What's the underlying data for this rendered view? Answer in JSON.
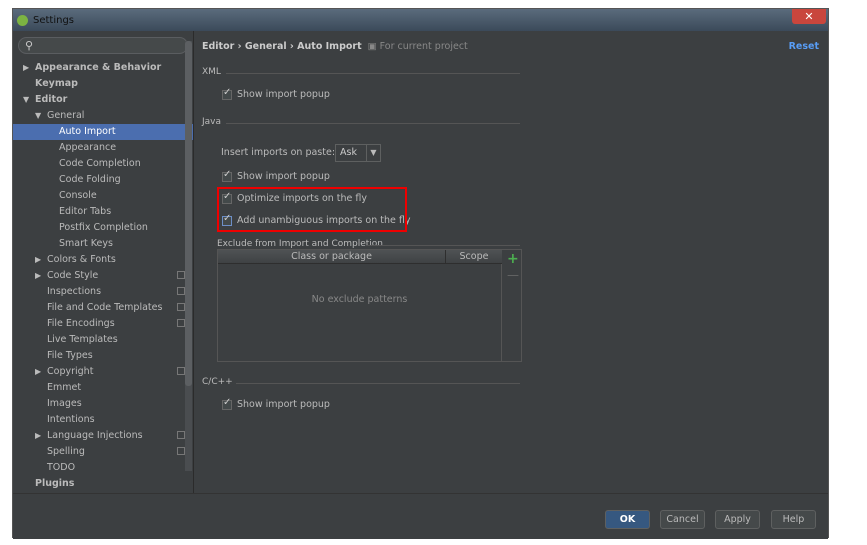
{
  "window": {
    "title": "Settings",
    "close": "✕"
  },
  "search": {
    "placeholder": ""
  },
  "tree": [
    {
      "label": "Appearance & Behavior",
      "level": 0,
      "bold": true,
      "arrow": "▶"
    },
    {
      "label": "Keymap",
      "level": 0,
      "bold": true,
      "arrow": ""
    },
    {
      "label": "Editor",
      "level": 0,
      "bold": true,
      "arrow": "▼"
    },
    {
      "label": "General",
      "level": 1,
      "arrow": "▼"
    },
    {
      "label": "Auto Import",
      "level": 2,
      "selected": true
    },
    {
      "label": "Appearance",
      "level": 2
    },
    {
      "label": "Code Completion",
      "level": 2
    },
    {
      "label": "Code Folding",
      "level": 2
    },
    {
      "label": "Console",
      "level": 2
    },
    {
      "label": "Editor Tabs",
      "level": 2
    },
    {
      "label": "Postfix Completion",
      "level": 2
    },
    {
      "label": "Smart Keys",
      "level": 2
    },
    {
      "label": "Colors & Fonts",
      "level": 1,
      "arrow": "▶"
    },
    {
      "label": "Code Style",
      "level": 1,
      "arrow": "▶",
      "project": true
    },
    {
      "label": "Inspections",
      "level": 1,
      "project": true
    },
    {
      "label": "File and Code Templates",
      "level": 1,
      "project": true
    },
    {
      "label": "File Encodings",
      "level": 1,
      "project": true
    },
    {
      "label": "Live Templates",
      "level": 1
    },
    {
      "label": "File Types",
      "level": 1
    },
    {
      "label": "Copyright",
      "level": 1,
      "arrow": "▶",
      "project": true
    },
    {
      "label": "Emmet",
      "level": 1
    },
    {
      "label": "Images",
      "level": 1
    },
    {
      "label": "Intentions",
      "level": 1
    },
    {
      "label": "Language Injections",
      "level": 1,
      "arrow": "▶",
      "project": true
    },
    {
      "label": "Spelling",
      "level": 1,
      "project": true
    },
    {
      "label": "TODO",
      "level": 1
    },
    {
      "label": "Plugins",
      "level": 0,
      "bold": true
    }
  ],
  "breadcrumb": {
    "path": "Editor › General › Auto Import",
    "scope": "For current project"
  },
  "reset": "Reset",
  "xml": {
    "title": "XML",
    "show_popup": "Show import popup"
  },
  "java": {
    "title": "Java",
    "insert_label": "Insert imports on paste:",
    "insert_value": "Ask",
    "show_popup": "Show import popup",
    "optimize": "Optimize imports on the fly",
    "add_unambiguous": "Add unambiguous imports on the fly",
    "exclude_title": "Exclude from Import and Completion",
    "col_class": "Class or package",
    "col_scope": "Scope",
    "empty": "No exclude patterns"
  },
  "cpp": {
    "title": "C/C++",
    "show_popup": "Show import popup"
  },
  "buttons": {
    "ok": "OK",
    "cancel": "Cancel",
    "apply": "Apply",
    "help": "Help"
  },
  "colors": {
    "selection": "#4b6eaf",
    "highlight": "#e00000",
    "link": "#589df6"
  }
}
